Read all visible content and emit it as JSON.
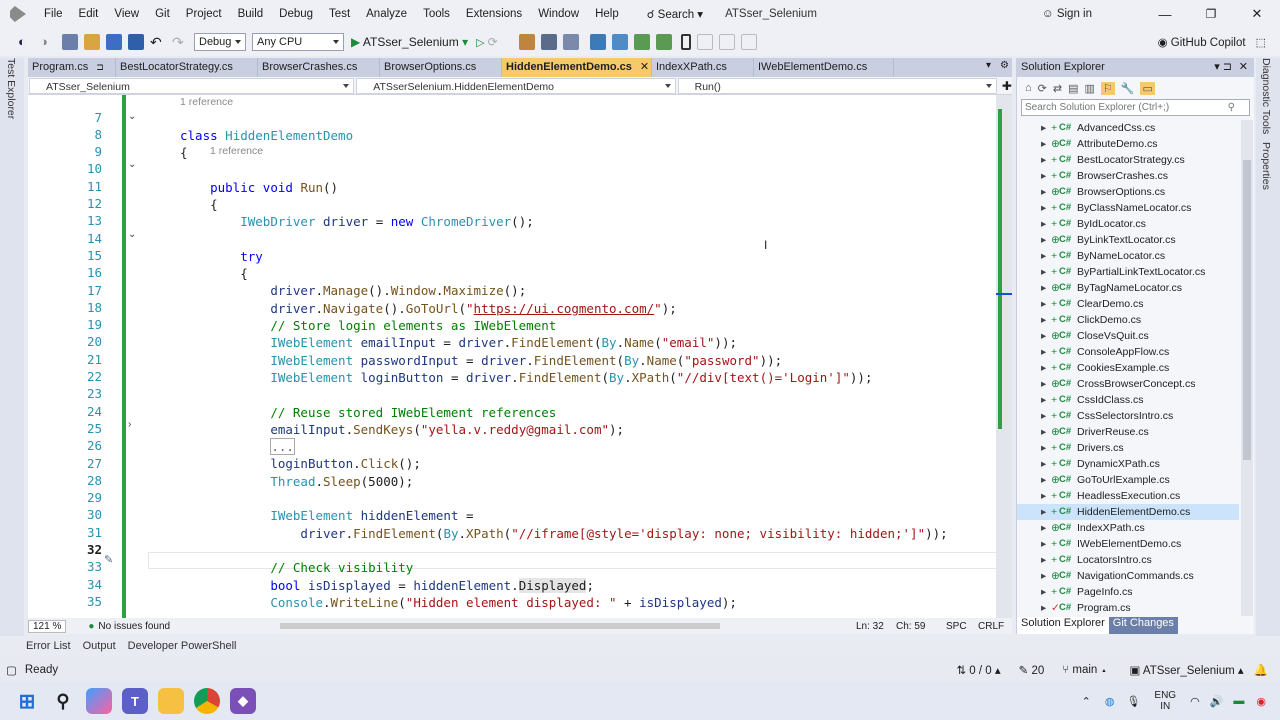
{
  "menu": [
    "File",
    "Edit",
    "View",
    "Git",
    "Project",
    "Build",
    "Debug",
    "Test",
    "Analyze",
    "Tools",
    "Extensions",
    "Window",
    "Help"
  ],
  "search_label": "Search",
  "solution_title": "ATSser_Selenium",
  "sign_in": "Sign in",
  "toolbar": {
    "config": "Debug",
    "platform": "Any CPU",
    "run_target": "ATSser_Selenium",
    "copilot": "GitHub Copilot"
  },
  "tabs": [
    "Program.cs",
    "BestLocatorStrategy.cs",
    "BrowserCrashes.cs",
    "BrowserOptions.cs",
    "HiddenElementDemo.cs",
    "IndexXPath.cs",
    "IWebElementDemo.cs"
  ],
  "active_tab": "HiddenElementDemo.cs",
  "nav": {
    "project": "ATSser_Selenium",
    "class": "ATSserSelenium.HiddenElementDemo",
    "member": "Run()"
  },
  "side_rail": [
    "Test Explorer"
  ],
  "right_rail": [
    "Diagnostic Tools",
    "Properties"
  ],
  "code": {
    "ref1": "1 reference",
    "ref2": "1 reference",
    "line_numbers": [
      "7",
      "8",
      "9",
      "10",
      "11",
      "12",
      "13",
      "14",
      "15",
      "16",
      "17",
      "18",
      "19",
      "20",
      "21",
      "22",
      "23",
      "24",
      "25",
      "26",
      "27",
      "28",
      "29",
      "30",
      "31",
      "32",
      "33",
      "34",
      "35"
    ],
    "current_line": "32"
  },
  "editor_status": {
    "zoom": "121 %",
    "issues": "No issues found",
    "ln": "Ln: 32",
    "ch": "Ch: 59",
    "spc": "SPC",
    "crlf": "CRLF"
  },
  "bottom_tabs": [
    "Error List",
    "Output",
    "Developer PowerShell"
  ],
  "solution_explorer": {
    "title": "Solution Explorer",
    "search_placeholder": "Search Solution Explorer (Ctrl+;)",
    "files": [
      "AdvancedCss.cs",
      "AttributeDemo.cs",
      "BestLocatorStrategy.cs",
      "BrowserCrashes.cs",
      "BrowserOptions.cs",
      "ByClassNameLocator.cs",
      "ByIdLocator.cs",
      "ByLinkTextLocator.cs",
      "ByNameLocator.cs",
      "ByPartialLinkTextLocator.cs",
      "ByTagNameLocator.cs",
      "ClearDemo.cs",
      "ClickDemo.cs",
      "CloseVsQuit.cs",
      "ConsoleAppFlow.cs",
      "CookiesExample.cs",
      "CrossBrowserConcept.cs",
      "CssIdClass.cs",
      "CssSelectorsIntro.cs",
      "DriverReuse.cs",
      "Drivers.cs",
      "DynamicXPath.cs",
      "GoToUrlExample.cs",
      "HeadlessExecution.cs",
      "HiddenElementDemo.cs",
      "IndexXPath.cs",
      "IWebElementDemo.cs",
      "LocatorsIntro.cs",
      "NavigationCommands.cs",
      "PageInfo.cs",
      "Program.cs"
    ],
    "selected": "HiddenElementDemo.cs",
    "tabs": [
      "Solution Explorer",
      "Git Changes"
    ]
  },
  "status": {
    "ready": "Ready",
    "arrows": "0 / 0",
    "pencil": "20",
    "branch": "main",
    "repo": "ATSser_Selenium"
  },
  "tray": {
    "lang1": "ENG",
    "lang2": "IN"
  },
  "colors": {
    "accent": "#68217a",
    "active_tab": "#f9c86c",
    "green_bar": "#2ea043",
    "selection": "#cbe4fb"
  }
}
